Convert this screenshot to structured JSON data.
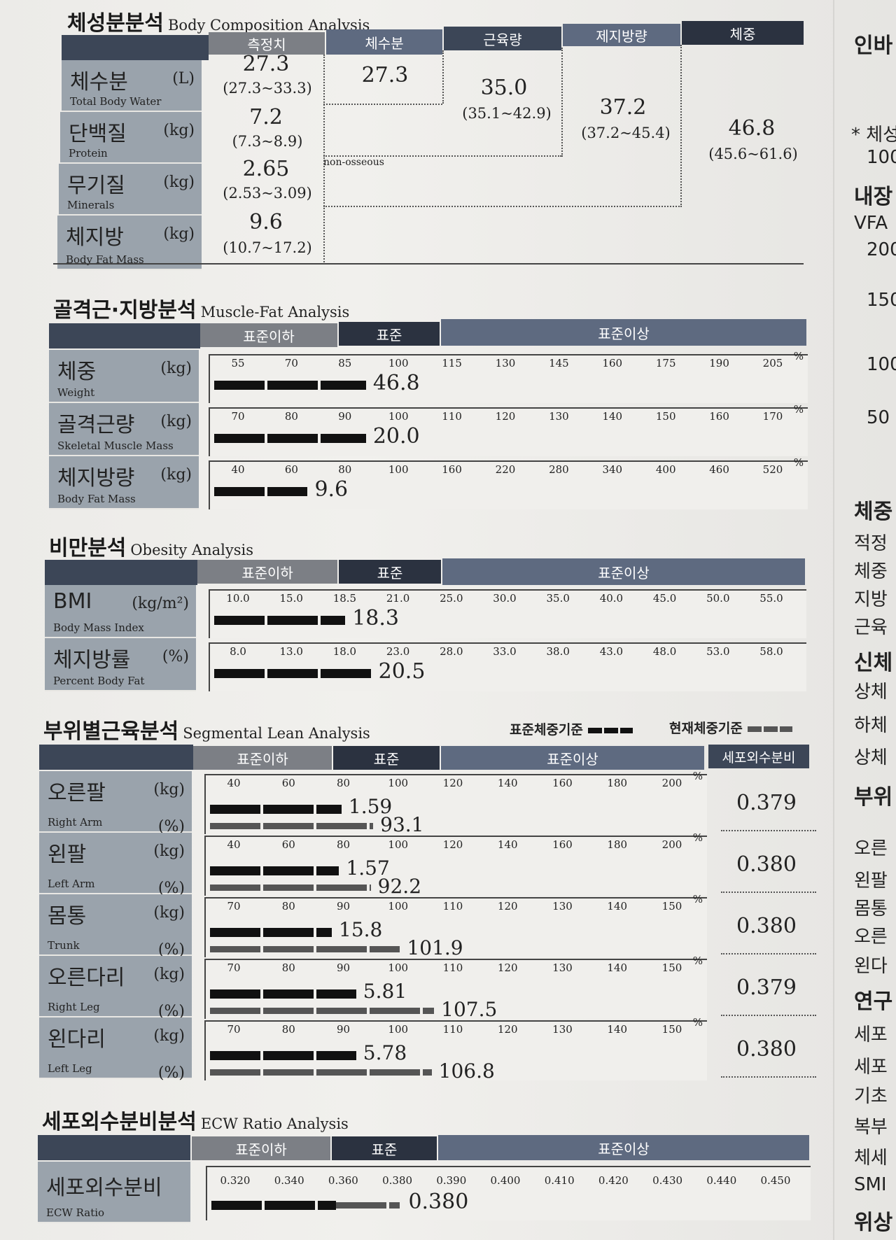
{
  "bca": {
    "title_ko": "체성분분석",
    "title_en": "Body Composition Analysis",
    "columns": [
      "측정치",
      "체수분",
      "근육량",
      "제지방량",
      "체중"
    ],
    "rows": [
      {
        "ko": "체수분",
        "en": "Total Body Water",
        "unit": "(L)",
        "value": "27.3",
        "range": "(27.3~33.3)"
      },
      {
        "ko": "단백질",
        "en": "Protein",
        "unit": "(kg)",
        "value": "7.2",
        "range": "(7.3~8.9)"
      },
      {
        "ko": "무기질",
        "en": "Minerals",
        "unit": "(kg)",
        "value": "2.65",
        "range": "(2.53~3.09)"
      },
      {
        "ko": "체지방",
        "en": "Body Fat Mass",
        "unit": "(kg)",
        "value": "9.6",
        "range": "(10.7~17.2)"
      }
    ],
    "tbw": "27.3",
    "muscle": "35.0",
    "muscle_range": "(35.1~42.9)",
    "ffm": "37.2",
    "ffm_range": "(37.2~45.4)",
    "weight": "46.8",
    "weight_range": "(45.6~61.6)",
    "non_osseous": "non-osseous"
  },
  "levels": {
    "below": "표준이하",
    "std": "표준",
    "above": "표준이상"
  },
  "mfa": {
    "title_ko": "골격근·지방분석",
    "title_en": "Muscle-Fat Analysis",
    "rows": [
      {
        "ko": "체중",
        "en": "Weight",
        "unit": "(kg)",
        "ticks": [
          "55",
          "70",
          "85",
          "100",
          "115",
          "130",
          "145",
          "160",
          "175",
          "190",
          "205"
        ],
        "value": "46.8",
        "fraction": 0.26
      },
      {
        "ko": "골격근량",
        "en": "Skeletal Muscle Mass",
        "unit": "(kg)",
        "ticks": [
          "70",
          "80",
          "90",
          "100",
          "110",
          "120",
          "130",
          "140",
          "150",
          "160",
          "170"
        ],
        "value": "20.0",
        "fraction": 0.26
      },
      {
        "ko": "체지방량",
        "en": "Body Fat Mass",
        "unit": "(kg)",
        "ticks": [
          "40",
          "60",
          "80",
          "100",
          "160",
          "220",
          "280",
          "340",
          "400",
          "460",
          "520"
        ],
        "value": "9.6",
        "fraction": 0.16
      }
    ],
    "pct": "%"
  },
  "oa": {
    "title_ko": "비만분석",
    "title_en": "Obesity Analysis",
    "rows": [
      {
        "ko": "BMI",
        "en": "Body Mass Index",
        "unit": "(kg/m²)",
        "ticks": [
          "10.0",
          "15.0",
          "18.5",
          "21.0",
          "25.0",
          "30.0",
          "35.0",
          "40.0",
          "45.0",
          "50.0",
          "55.0"
        ],
        "value": "18.3",
        "fraction": 0.225
      },
      {
        "ko": "체지방률",
        "en": "Percent Body Fat",
        "unit": "(%)",
        "ticks": [
          "8.0",
          "13.0",
          "18.0",
          "23.0",
          "28.0",
          "33.0",
          "38.0",
          "43.0",
          "48.0",
          "53.0",
          "58.0"
        ],
        "value": "20.5",
        "fraction": 0.27
      }
    ]
  },
  "sla": {
    "title_ko": "부위별근육분석",
    "title_en": "Segmental Lean Analysis",
    "legend_std": "표준체중기준",
    "legend_cur": "현재체중기준",
    "ecw_header": "세포외수분비",
    "rows": [
      {
        "ko": "오른팔",
        "en": "Right Arm",
        "ticks": [
          "40",
          "60",
          "80",
          "100",
          "120",
          "140",
          "160",
          "180",
          "200"
        ],
        "kg": "1.59",
        "pct": "93.1",
        "kg_fraction": 0.27,
        "pct_fraction": 0.335,
        "ecw": "0.379"
      },
      {
        "ko": "왼팔",
        "en": "Left Arm",
        "ticks": [
          "40",
          "60",
          "80",
          "100",
          "120",
          "140",
          "160",
          "180",
          "200"
        ],
        "kg": "1.57",
        "pct": "92.2",
        "kg_fraction": 0.265,
        "pct_fraction": 0.33,
        "ecw": "0.380"
      },
      {
        "ko": "몸통",
        "en": "Trunk",
        "ticks": [
          "70",
          "80",
          "90",
          "100",
          "110",
          "120",
          "130",
          "140",
          "150"
        ],
        "kg": "15.8",
        "pct": "101.9",
        "kg_fraction": 0.25,
        "pct_fraction": 0.39,
        "ecw": "0.380"
      },
      {
        "ko": "오른다리",
        "en": "Right Leg",
        "ticks": [
          "70",
          "80",
          "90",
          "100",
          "110",
          "120",
          "130",
          "140",
          "150"
        ],
        "kg": "5.81",
        "pct": "107.5",
        "kg_fraction": 0.3,
        "pct_fraction": 0.46,
        "ecw": "0.379"
      },
      {
        "ko": "왼다리",
        "en": "Left Leg",
        "ticks": [
          "70",
          "80",
          "90",
          "100",
          "110",
          "120",
          "130",
          "140",
          "150"
        ],
        "kg": "5.78",
        "pct": "106.8",
        "kg_fraction": 0.3,
        "pct_fraction": 0.455,
        "ecw": "0.380"
      }
    ]
  },
  "ecwa": {
    "title_ko": "세포외수분비분석",
    "title_en": "ECW Ratio Analysis",
    "row": {
      "ko": "세포외수분비",
      "en": "ECW Ratio",
      "ticks": [
        "0.320",
        "0.340",
        "0.360",
        "0.380",
        "0.390",
        "0.400",
        "0.410",
        "0.420",
        "0.430",
        "0.440",
        "0.450"
      ],
      "value": "0.380",
      "fraction": 0.32
    }
  },
  "right_col": [
    {
      "text": "인바",
      "bold": true
    },
    {
      "text": "* 체성",
      "bold": false
    },
    {
      "text": "100",
      "bold": false
    },
    {
      "text": "내장",
      "bold": true
    },
    {
      "text": "VFA",
      "bold": false
    },
    {
      "text": "200",
      "bold": false
    },
    {
      "text": "150",
      "bold": false
    },
    {
      "text": "100",
      "bold": false
    },
    {
      "text": "50",
      "bold": false
    },
    {
      "text": "체중",
      "bold": true
    },
    {
      "text": "적정",
      "bold": false
    },
    {
      "text": "체중",
      "bold": false
    },
    {
      "text": "지방",
      "bold": false
    },
    {
      "text": "근육",
      "bold": false
    },
    {
      "text": "신체",
      "bold": true
    },
    {
      "text": "상체",
      "bold": false
    },
    {
      "text": "하체",
      "bold": false
    },
    {
      "text": "상체",
      "bold": false
    },
    {
      "text": "부위",
      "bold": true
    },
    {
      "text": "오른",
      "bold": false
    },
    {
      "text": "왼팔",
      "bold": false
    },
    {
      "text": "몸통",
      "bold": false
    },
    {
      "text": "오른",
      "bold": false
    },
    {
      "text": "왼다",
      "bold": false
    },
    {
      "text": "연구",
      "bold": true
    },
    {
      "text": "세포",
      "bold": false
    },
    {
      "text": "세포",
      "bold": false
    },
    {
      "text": "기초",
      "bold": false
    },
    {
      "text": "복부",
      "bold": false
    },
    {
      "text": "체세",
      "bold": false
    },
    {
      "text": "SMI",
      "bold": false
    },
    {
      "text": "위상",
      "bold": true
    }
  ]
}
